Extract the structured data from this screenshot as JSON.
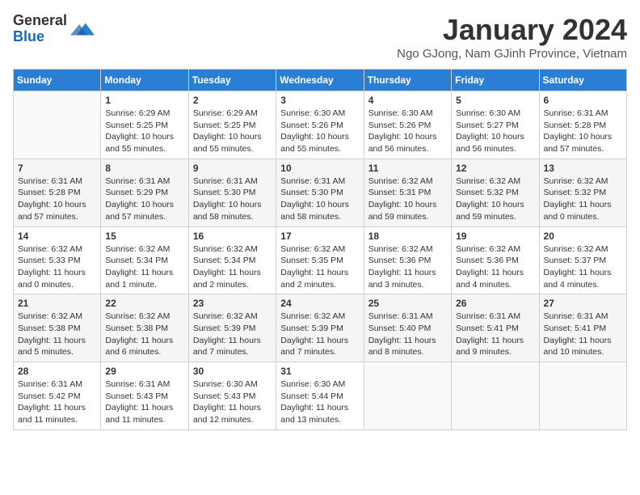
{
  "header": {
    "logo_general": "General",
    "logo_blue": "Blue",
    "month_title": "January 2024",
    "location": "Ngo GJong, Nam GJinh Province, Vietnam"
  },
  "days_of_week": [
    "Sunday",
    "Monday",
    "Tuesday",
    "Wednesday",
    "Thursday",
    "Friday",
    "Saturday"
  ],
  "weeks": [
    [
      {
        "day": "",
        "info": ""
      },
      {
        "day": "1",
        "info": "Sunrise: 6:29 AM\nSunset: 5:25 PM\nDaylight: 10 hours\nand 55 minutes."
      },
      {
        "day": "2",
        "info": "Sunrise: 6:29 AM\nSunset: 5:25 PM\nDaylight: 10 hours\nand 55 minutes."
      },
      {
        "day": "3",
        "info": "Sunrise: 6:30 AM\nSunset: 5:26 PM\nDaylight: 10 hours\nand 55 minutes."
      },
      {
        "day": "4",
        "info": "Sunrise: 6:30 AM\nSunset: 5:26 PM\nDaylight: 10 hours\nand 56 minutes."
      },
      {
        "day": "5",
        "info": "Sunrise: 6:30 AM\nSunset: 5:27 PM\nDaylight: 10 hours\nand 56 minutes."
      },
      {
        "day": "6",
        "info": "Sunrise: 6:31 AM\nSunset: 5:28 PM\nDaylight: 10 hours\nand 57 minutes."
      }
    ],
    [
      {
        "day": "7",
        "info": "Sunrise: 6:31 AM\nSunset: 5:28 PM\nDaylight: 10 hours\nand 57 minutes."
      },
      {
        "day": "8",
        "info": "Sunrise: 6:31 AM\nSunset: 5:29 PM\nDaylight: 10 hours\nand 57 minutes."
      },
      {
        "day": "9",
        "info": "Sunrise: 6:31 AM\nSunset: 5:30 PM\nDaylight: 10 hours\nand 58 minutes."
      },
      {
        "day": "10",
        "info": "Sunrise: 6:31 AM\nSunset: 5:30 PM\nDaylight: 10 hours\nand 58 minutes."
      },
      {
        "day": "11",
        "info": "Sunrise: 6:32 AM\nSunset: 5:31 PM\nDaylight: 10 hours\nand 59 minutes."
      },
      {
        "day": "12",
        "info": "Sunrise: 6:32 AM\nSunset: 5:32 PM\nDaylight: 10 hours\nand 59 minutes."
      },
      {
        "day": "13",
        "info": "Sunrise: 6:32 AM\nSunset: 5:32 PM\nDaylight: 11 hours\nand 0 minutes."
      }
    ],
    [
      {
        "day": "14",
        "info": "Sunrise: 6:32 AM\nSunset: 5:33 PM\nDaylight: 11 hours\nand 0 minutes."
      },
      {
        "day": "15",
        "info": "Sunrise: 6:32 AM\nSunset: 5:34 PM\nDaylight: 11 hours\nand 1 minute."
      },
      {
        "day": "16",
        "info": "Sunrise: 6:32 AM\nSunset: 5:34 PM\nDaylight: 11 hours\nand 2 minutes."
      },
      {
        "day": "17",
        "info": "Sunrise: 6:32 AM\nSunset: 5:35 PM\nDaylight: 11 hours\nand 2 minutes."
      },
      {
        "day": "18",
        "info": "Sunrise: 6:32 AM\nSunset: 5:36 PM\nDaylight: 11 hours\nand 3 minutes."
      },
      {
        "day": "19",
        "info": "Sunrise: 6:32 AM\nSunset: 5:36 PM\nDaylight: 11 hours\nand 4 minutes."
      },
      {
        "day": "20",
        "info": "Sunrise: 6:32 AM\nSunset: 5:37 PM\nDaylight: 11 hours\nand 4 minutes."
      }
    ],
    [
      {
        "day": "21",
        "info": "Sunrise: 6:32 AM\nSunset: 5:38 PM\nDaylight: 11 hours\nand 5 minutes."
      },
      {
        "day": "22",
        "info": "Sunrise: 6:32 AM\nSunset: 5:38 PM\nDaylight: 11 hours\nand 6 minutes."
      },
      {
        "day": "23",
        "info": "Sunrise: 6:32 AM\nSunset: 5:39 PM\nDaylight: 11 hours\nand 7 minutes."
      },
      {
        "day": "24",
        "info": "Sunrise: 6:32 AM\nSunset: 5:39 PM\nDaylight: 11 hours\nand 7 minutes."
      },
      {
        "day": "25",
        "info": "Sunrise: 6:31 AM\nSunset: 5:40 PM\nDaylight: 11 hours\nand 8 minutes."
      },
      {
        "day": "26",
        "info": "Sunrise: 6:31 AM\nSunset: 5:41 PM\nDaylight: 11 hours\nand 9 minutes."
      },
      {
        "day": "27",
        "info": "Sunrise: 6:31 AM\nSunset: 5:41 PM\nDaylight: 11 hours\nand 10 minutes."
      }
    ],
    [
      {
        "day": "28",
        "info": "Sunrise: 6:31 AM\nSunset: 5:42 PM\nDaylight: 11 hours\nand 11 minutes."
      },
      {
        "day": "29",
        "info": "Sunrise: 6:31 AM\nSunset: 5:43 PM\nDaylight: 11 hours\nand 11 minutes."
      },
      {
        "day": "30",
        "info": "Sunrise: 6:30 AM\nSunset: 5:43 PM\nDaylight: 11 hours\nand 12 minutes."
      },
      {
        "day": "31",
        "info": "Sunrise: 6:30 AM\nSunset: 5:44 PM\nDaylight: 11 hours\nand 13 minutes."
      },
      {
        "day": "",
        "info": ""
      },
      {
        "day": "",
        "info": ""
      },
      {
        "day": "",
        "info": ""
      }
    ]
  ]
}
